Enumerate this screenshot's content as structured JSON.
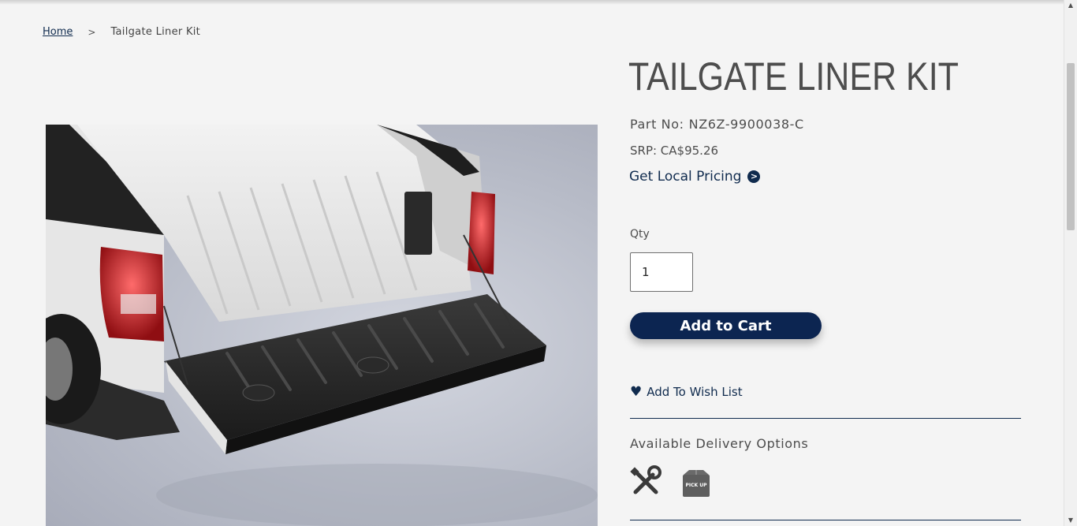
{
  "breadcrumb": {
    "home": "Home",
    "separator": ">",
    "current": "Tailgate Liner Kit"
  },
  "product": {
    "title": "TAILGATE LINER KIT",
    "part_no_label": "Part No:",
    "part_no_value": "NZ6Z-9900038-C",
    "srp": "SRP: CA$95.26",
    "local_pricing": "Get Local Pricing",
    "local_pricing_icon": ">",
    "image_alt": "White pickup truck bed with black tailgate liner"
  },
  "purchase": {
    "qty_label": "Qty",
    "qty_value": "1",
    "add_to_cart": "Add to Cart",
    "wish_list": "Add To Wish List",
    "wish_icon": "♥"
  },
  "delivery": {
    "title": "Available Delivery Options",
    "options": [
      {
        "icon": "tools-icon"
      },
      {
        "icon": "pickup-box-icon",
        "label": "PICK UP"
      }
    ]
  },
  "colors": {
    "brand_navy": "#0c2551",
    "link_navy": "#102b4e",
    "background": "#f4f4f4"
  }
}
